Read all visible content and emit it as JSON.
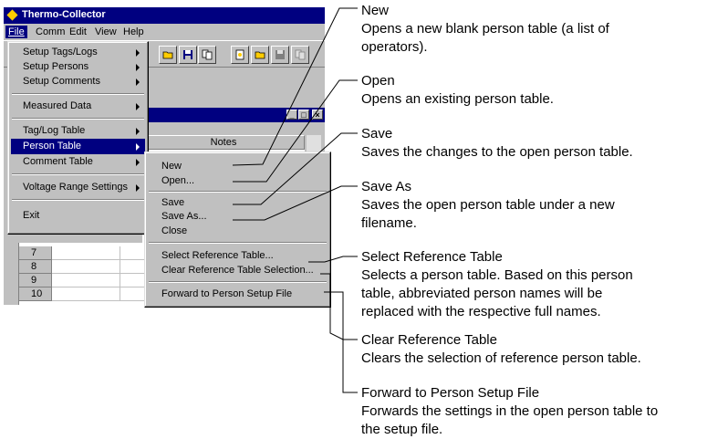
{
  "window": {
    "title": "Thermo-Collector",
    "menubar": [
      "File",
      "Comm",
      "Edit",
      "View",
      "Help"
    ]
  },
  "toolbar": {
    "icons": [
      "open-folder-icon",
      "save-disk-icon",
      "copy-icon",
      "new-doc-icon",
      "open-folder-icon",
      "save-disk-icon",
      "copy-icon"
    ]
  },
  "child_window": {
    "column_header": "Notes",
    "buttons": [
      "_",
      "□",
      "×"
    ]
  },
  "grid": {
    "rows": [
      "7",
      "8",
      "9",
      "10"
    ]
  },
  "file_menu": {
    "items": [
      {
        "label": "Setup Tags/Logs",
        "submenu": true
      },
      {
        "label": "Setup Persons",
        "submenu": true
      },
      {
        "label": "Setup Comments",
        "submenu": true
      },
      {
        "label": "Measured Data",
        "submenu": true
      },
      {
        "label": "Tag/Log Table",
        "submenu": true
      },
      {
        "label": "Person Table",
        "submenu": true,
        "selected": true
      },
      {
        "label": "Comment Table",
        "submenu": true
      },
      {
        "label": "Voltage Range Settings",
        "submenu": true
      },
      {
        "label": "Exit",
        "submenu": false
      }
    ]
  },
  "person_table_menu": {
    "items": [
      "New",
      "Open...",
      "Save",
      "Save As...",
      "Close",
      "Select Reference Table...",
      "Clear Reference Table Selection...",
      "Forward to Person Setup File"
    ]
  },
  "annotations": [
    {
      "title": "New",
      "lines": [
        "Opens a new blank person table (a list of",
        "operators)."
      ]
    },
    {
      "title": "Open",
      "lines": [
        "Opens an existing person table."
      ]
    },
    {
      "title": "Save",
      "lines": [
        "Saves the changes to the open person table."
      ]
    },
    {
      "title": "Save As",
      "lines": [
        "Saves the open person table under a new",
        "filename."
      ]
    },
    {
      "title": "Select Reference Table",
      "lines": [
        "Selects a person table.  Based on this person",
        "table, abbreviated person names will be",
        "replaced with the respective full names."
      ]
    },
    {
      "title": "Clear Reference Table",
      "lines": [
        "Clears the selection of reference person table."
      ]
    },
    {
      "title": "Forward to Person Setup File",
      "lines": [
        "Forwards the settings in the open person table to",
        "the setup file."
      ]
    }
  ]
}
